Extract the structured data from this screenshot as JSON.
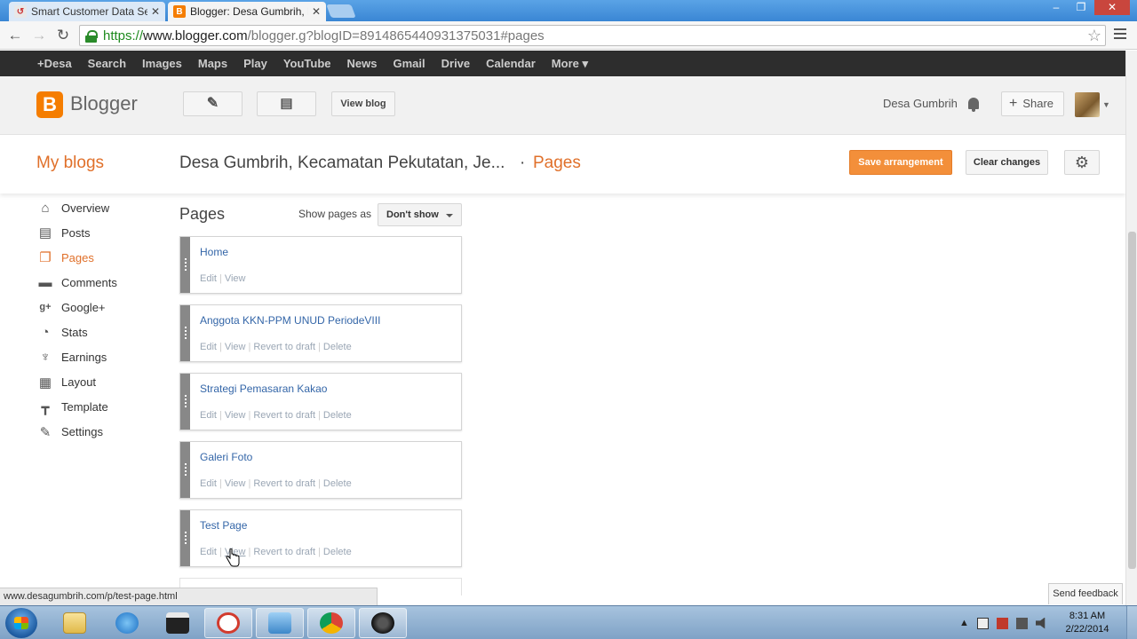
{
  "browser": {
    "tabs": [
      {
        "title": "Smart Customer Data Servi",
        "icon": "chrome-app-icon"
      },
      {
        "title": "Blogger: Desa Gumbrih, K",
        "icon": "blogger-icon"
      }
    ],
    "tab_close": "✕",
    "url": {
      "scheme": "https://",
      "host": "www.blogger.com",
      "path": "/blogger.g?blogID=8914865440931375031#pages"
    },
    "back": "←",
    "forward": "→",
    "reload": "↻",
    "star": "☆",
    "window_controls": {
      "minimize": "–",
      "restore": "❐",
      "close": "✕"
    }
  },
  "gbar": {
    "items": [
      "+Desa",
      "Search",
      "Images",
      "Maps",
      "Play",
      "YouTube",
      "News",
      "Gmail",
      "Drive",
      "Calendar",
      "More ▾"
    ]
  },
  "header": {
    "brand": "Blogger",
    "view_blog": "View blog",
    "user": "Desa Gumbrih",
    "share": "Share",
    "share_plus": "+"
  },
  "subheader": {
    "my_blogs": "My blogs",
    "blog_title": "Desa Gumbrih, Kecamatan Pekutatan, Je...",
    "separator": "·",
    "section": "Pages",
    "save": "Save arrangement",
    "clear": "Clear changes"
  },
  "nav": [
    {
      "label": "Overview",
      "icon": "home-icon",
      "glyph": "⌂"
    },
    {
      "label": "Posts",
      "icon": "posts-icon",
      "glyph": "▤"
    },
    {
      "label": "Pages",
      "icon": "pages-icon",
      "glyph": "❐"
    },
    {
      "label": "Comments",
      "icon": "comments-icon",
      "glyph": "▬"
    },
    {
      "label": "Google+",
      "icon": "google-plus-icon",
      "glyph": "g+"
    },
    {
      "label": "Stats",
      "icon": "stats-icon",
      "glyph": "◔"
    },
    {
      "label": "Earnings",
      "icon": "trophy-icon",
      "glyph": "♆"
    },
    {
      "label": "Layout",
      "icon": "layout-icon",
      "glyph": "▦"
    },
    {
      "label": "Template",
      "icon": "template-icon",
      "glyph": "┳"
    },
    {
      "label": "Settings",
      "icon": "wrench-icon",
      "glyph": "✎"
    }
  ],
  "pages_panel": {
    "heading": "Pages",
    "show_label": "Show pages as",
    "show_value": "Don't show",
    "items": [
      {
        "title": "Home",
        "actions": [
          "Edit",
          "View"
        ]
      },
      {
        "title": "Anggota KKN-PPM UNUD PeriodeVIII",
        "actions": [
          "Edit",
          "View",
          "Revert to draft",
          "Delete"
        ]
      },
      {
        "title": "Strategi Pemasaran Kakao",
        "actions": [
          "Edit",
          "View",
          "Revert to draft",
          "Delete"
        ]
      },
      {
        "title": "Galeri Foto",
        "actions": [
          "Edit",
          "View",
          "Revert to draft",
          "Delete"
        ]
      },
      {
        "title": "Test Page",
        "actions": [
          "Edit",
          "View",
          "Revert to draft",
          "Delete"
        ]
      }
    ]
  },
  "status_url": "www.desagumbrih.com/p/test-page.html",
  "feedback": "Send feedback",
  "taskbar": {
    "time": "8:31 AM",
    "date": "2/22/2014"
  },
  "colors": {
    "accent": "#e0702a",
    "save_button": "#f38f3a",
    "link": "#3466a8"
  }
}
